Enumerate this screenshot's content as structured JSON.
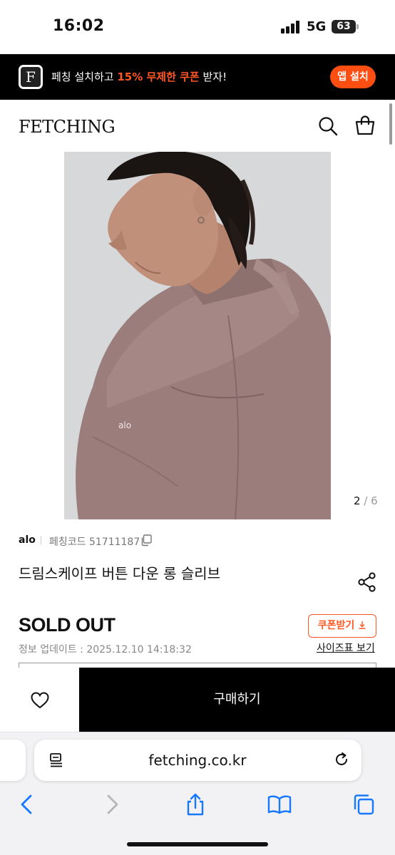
{
  "status_bar": {
    "time": "16:02",
    "network": "5G",
    "battery": "63"
  },
  "app_banner": {
    "logo_letter": "F",
    "text_prefix": "페칭 설치하고 ",
    "text_highlight": "15% 무제한 쿠폰",
    "text_suffix": " 받자!",
    "install_label": "앱 설치",
    "accent_color": "#ff4e12"
  },
  "header": {
    "logo": "FETCHING",
    "icons": [
      "search-icon",
      "shopping-bag-icon"
    ]
  },
  "gallery": {
    "current": "2",
    "separator": "/",
    "total": "6",
    "image_logo": "alo"
  },
  "product": {
    "brand": "alo",
    "code_label": "페칭코드",
    "code": "51711187",
    "name": "드림스케이프 버튼 다운 롱 슬리브",
    "status": "SOLD OUT",
    "update_label": "정보 업데이트 : ",
    "update_time": "2025.12.10 14:18:32",
    "coupon_label": "쿠폰받기",
    "size_chart_label": "사이즈표 보기"
  },
  "action_bar": {
    "buy_label": "구매하기",
    "wish_icon": "heart-icon"
  },
  "browser": {
    "url": "fetching.co.kr",
    "icons": [
      "reader-icon",
      "reload-icon",
      "back-icon",
      "forward-icon",
      "share-icon",
      "bookmarks-icon",
      "tabs-icon"
    ]
  }
}
